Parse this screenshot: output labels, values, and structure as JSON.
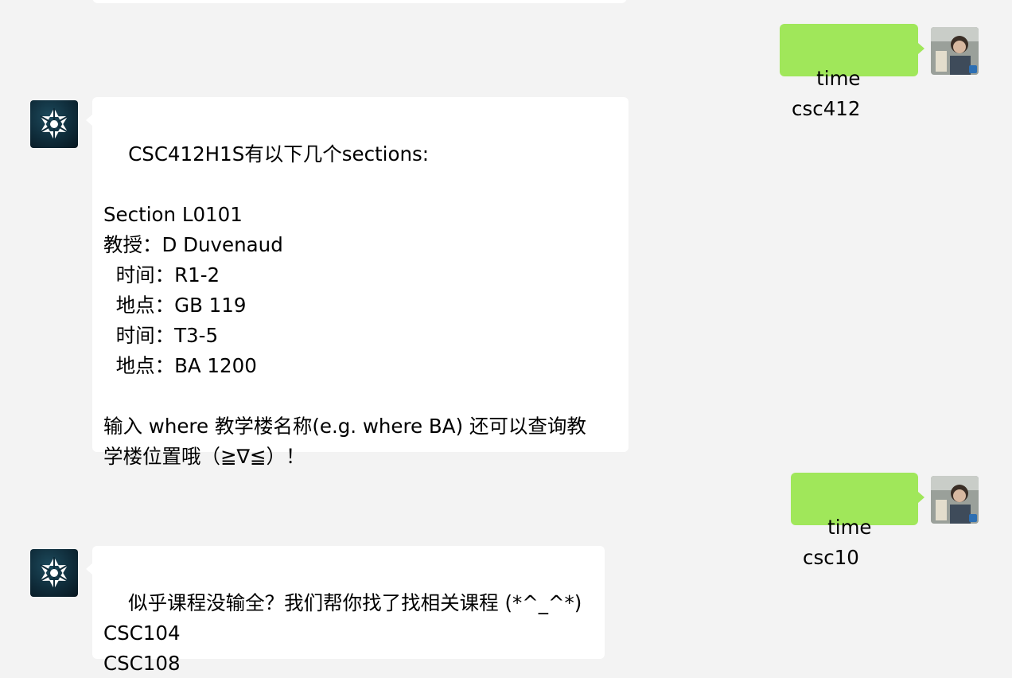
{
  "messages": [
    {
      "sender": "user",
      "text": "time csc412"
    },
    {
      "sender": "bot",
      "text": "CSC412H1S有以下几个sections:\n\nSection L0101\n教授：D Duvenaud\n  时间：R1-2\n  地点：GB 119\n  时间：T3-5\n  地点：BA 1200\n\n输入 where 教学楼名称(e.g. where BA) 还可以查询教\n学楼位置哦（≧∇≦）！"
    },
    {
      "sender": "user",
      "text": "time csc10"
    },
    {
      "sender": "bot",
      "text": "似乎课程没输全？我们帮你找了找相关课程 (*^_^*)\nCSC104\nCSC108"
    }
  ],
  "colors": {
    "background": "#f3f3f3",
    "bot_bubble": "#ffffff",
    "user_bubble": "#a0e75a"
  },
  "icons": {
    "bot_avatar": "snowflake-logo-icon",
    "user_avatar": "user-photo-avatar"
  }
}
